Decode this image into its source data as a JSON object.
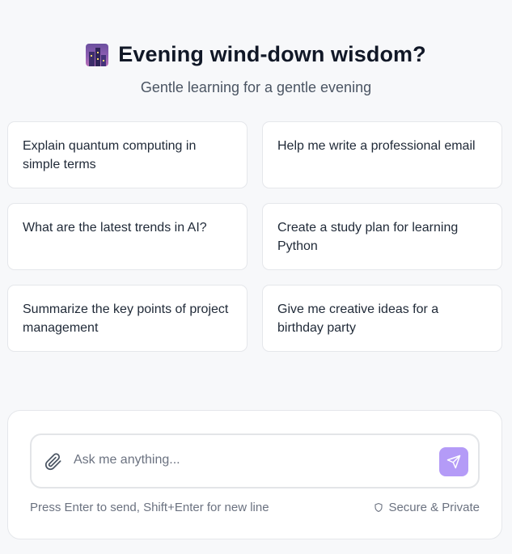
{
  "hero": {
    "icon": "night-city-icon",
    "title": "Evening wind-down wisdom?",
    "subtitle": "Gentle learning for a gentle evening"
  },
  "suggestions": [
    "Explain quantum computing in simple terms",
    "Help me write a professional email",
    "What are the latest trends in AI?",
    "Create a study plan for learning Python",
    "Summarize the key points of project management",
    "Give me creative ideas for a birthday party"
  ],
  "composer": {
    "placeholder": "Ask me anything...",
    "value": "",
    "attach_icon": "paperclip-icon",
    "send_icon": "send-icon",
    "hint": "Press Enter to send, Shift+Enter for new line",
    "secure_icon": "shield-icon",
    "secure_label": "Secure & Private"
  },
  "colors": {
    "background": "#f7f8fa",
    "accent": "#b49bf7",
    "title": "#111827",
    "muted": "#6b7280"
  }
}
